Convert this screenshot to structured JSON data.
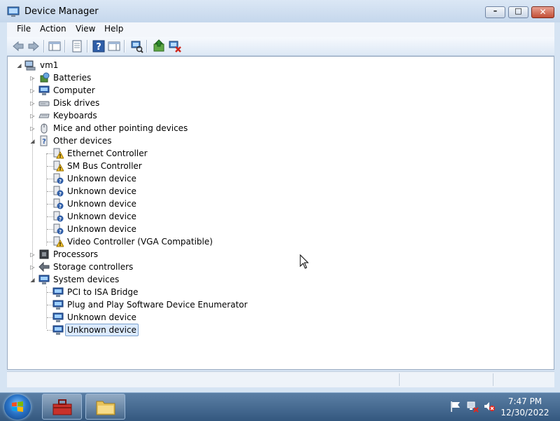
{
  "window": {
    "title": "Device Manager"
  },
  "menu": [
    "File",
    "Action",
    "View",
    "Help"
  ],
  "tree": {
    "root": "vm1",
    "categories": [
      {
        "label": "Batteries"
      },
      {
        "label": "Computer"
      },
      {
        "label": "Disk drives"
      },
      {
        "label": "Keyboards"
      },
      {
        "label": "Mice and other pointing devices"
      },
      {
        "label": "Other devices",
        "children": [
          "Ethernet Controller",
          "SM Bus Controller",
          "Unknown device",
          "Unknown device",
          "Unknown device",
          "Unknown device",
          "Unknown device",
          "Video Controller (VGA Compatible)"
        ]
      },
      {
        "label": "Processors"
      },
      {
        "label": "Storage controllers"
      },
      {
        "label": "System devices",
        "children": [
          "PCI to ISA Bridge",
          "Plug and Play Software Device Enumerator",
          "Unknown device",
          "Unknown device"
        ]
      }
    ],
    "selected": "Unknown device"
  },
  "taskbar": {
    "time": "7:47 PM",
    "date": "12/30/2022"
  },
  "colors": {
    "selection": "#dbeafe",
    "warning": "#f4c430",
    "taskbar": "#34587f"
  }
}
